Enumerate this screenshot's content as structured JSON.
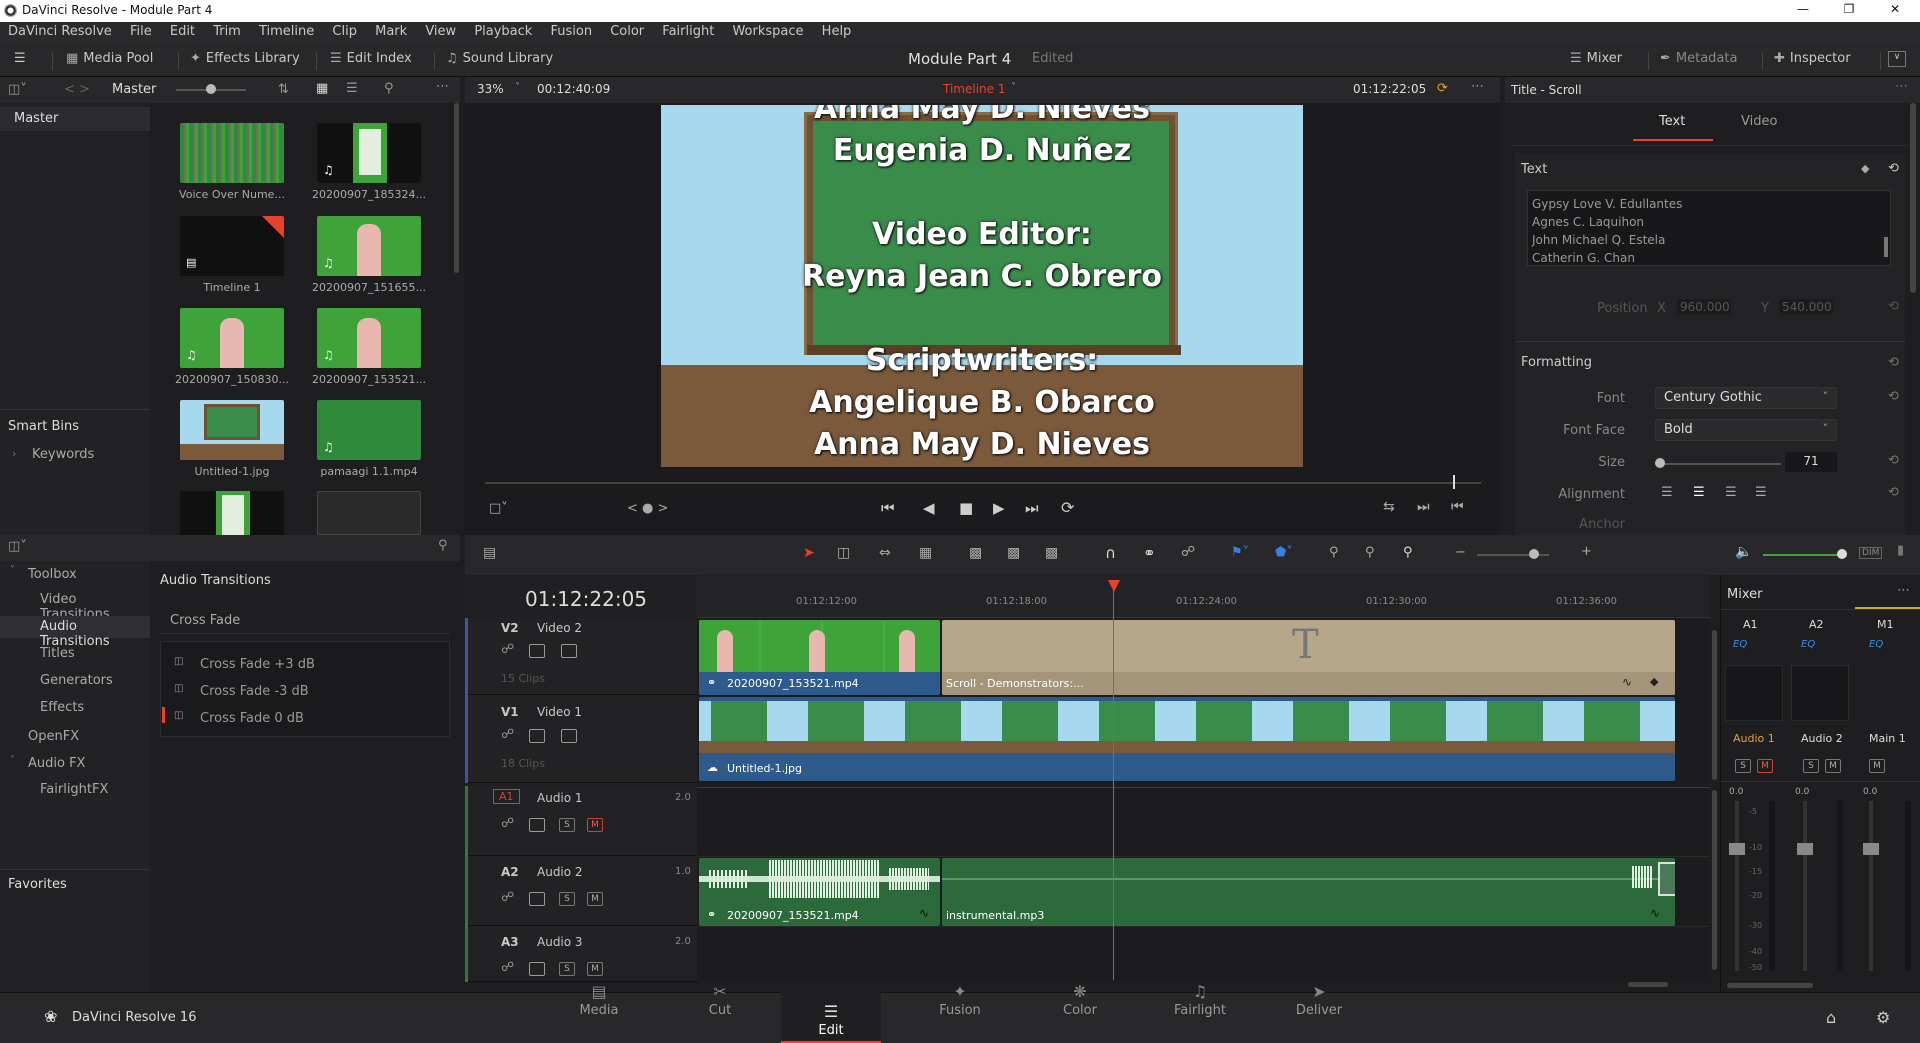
{
  "window": {
    "title": "DaVinci Resolve - Module Part 4"
  },
  "menu": [
    "DaVinci Resolve",
    "File",
    "Edit",
    "Trim",
    "Timeline",
    "Clip",
    "Mark",
    "View",
    "Playback",
    "Fusion",
    "Color",
    "Fairlight",
    "Workspace",
    "Help"
  ],
  "toolbar": {
    "media_pool": "Media Pool",
    "effects_library": "Effects Library",
    "edit_index": "Edit Index",
    "sound_library": "Sound Library",
    "project_title": "Module Part 4",
    "project_status": "Edited",
    "mixer": "Mixer",
    "metadata": "Metadata",
    "inspector": "Inspector"
  },
  "media_pool": {
    "bin_label": "Master",
    "master_item": "Master",
    "smart_bins": "Smart Bins",
    "keywords": "Keywords",
    "clips": [
      {
        "name": "Voice Over Nume..."
      },
      {
        "name": "20200907_185324..."
      },
      {
        "name": "Timeline 1"
      },
      {
        "name": "20200907_151655..."
      },
      {
        "name": "20200907_150830..."
      },
      {
        "name": "20200907_153521..."
      },
      {
        "name": "Untitled-1.jpg"
      },
      {
        "name": "pamaagi 1.1.mp4"
      }
    ]
  },
  "viewer": {
    "zoom": "33%",
    "duration": "00:12:40:09",
    "timeline_name": "Timeline 1",
    "timecode": "01:12:22:05",
    "credits": {
      "line0": "Anna May D. Nieves",
      "line1": "Eugenia D. Nuñez",
      "line2": "Video Editor:",
      "line3": "Reyna Jean C. Obrero",
      "line4": "Scriptwriters:",
      "line5": "Angelique B. Obarco",
      "line6": "Anna May D. Nieves"
    }
  },
  "inspector": {
    "title": "Title - Scroll",
    "tab_text": "Text",
    "tab_video": "Video",
    "section_text": "Text",
    "text_lines": [
      "Gypsy Love V. Edullantes",
      "Agnes C. Laquihon",
      "John Michael Q. Estela",
      "Catherin G. Chan"
    ],
    "position_label": "Position",
    "x_label": "X",
    "x_value": "960.000",
    "y_label": "Y",
    "y_value": "540.000",
    "section_formatting": "Formatting",
    "font_label": "Font",
    "font_value": "Century Gothic",
    "font_face_label": "Font Face",
    "font_face_value": "Bold",
    "size_label": "Size",
    "size_value": "71",
    "alignment_label": "Alignment",
    "anchor_label": "Anchor"
  },
  "effects": {
    "toolbox": "Toolbox",
    "video_transitions": "Video Transitions",
    "audio_transitions": "Audio Transitions",
    "titles": "Titles",
    "generators": "Generators",
    "effects": "Effects",
    "openfx": "OpenFX",
    "audio_fx": "Audio FX",
    "fairlightfx": "FairlightFX",
    "favorites": "Favorites",
    "panel_title": "Audio Transitions",
    "group": "Cross Fade",
    "items": [
      "Cross Fade +3 dB",
      "Cross Fade -3 dB",
      "Cross Fade 0 dB"
    ]
  },
  "timeline": {
    "timecode": "01:12:22:05",
    "ruler": [
      "01:12:12:00",
      "01:12:18:00",
      "01:12:24:00",
      "01:12:30:00",
      "01:12:36:00"
    ],
    "tracks": [
      {
        "id": "V2",
        "name": "Video 2",
        "clips": "15 Clips"
      },
      {
        "id": "V1",
        "name": "Video 1",
        "clips": "18 Clips"
      },
      {
        "id": "A1",
        "name": "Audio 1",
        "level": "2.0"
      },
      {
        "id": "A2",
        "name": "Audio 2",
        "level": "1.0"
      },
      {
        "id": "A3",
        "name": "Audio 3",
        "level": "2.0"
      }
    ],
    "clip_v2a": "20200907_153521.mp4",
    "clip_v2b": "Scroll - Demonstrators:...",
    "clip_v1": "Untitled-1.jpg",
    "clip_a2a": "20200907_153521.mp4",
    "clip_a2b": "instrumental.mp3",
    "s_label": "S",
    "m_label": "M"
  },
  "mixer": {
    "title": "Mixer",
    "channels": [
      "A1",
      "A2",
      "M1"
    ],
    "eq": "EQ",
    "names": [
      "Audio 1",
      "Audio 2",
      "Main 1"
    ],
    "level": "0.0",
    "scale": [
      "-5",
      "-10",
      "-15",
      "-20",
      "-30",
      "-40",
      "-50"
    ]
  },
  "footer": {
    "app": "DaVinci Resolve 16",
    "pages": [
      "Media",
      "Cut",
      "Edit",
      "Fusion",
      "Color",
      "Fairlight",
      "Deliver"
    ]
  },
  "colors": {
    "accent_red": "#e8412c",
    "clip_green": "#3ea43a",
    "audio_green": "#2c6a3c",
    "title_tan": "#b6a78a",
    "video_blue": "#2f5a8c"
  }
}
